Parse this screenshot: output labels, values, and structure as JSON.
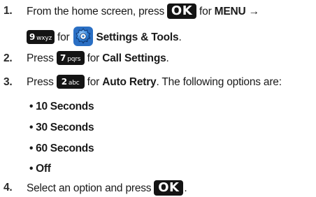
{
  "steps": [
    {
      "number": "1.",
      "pre": "From the home screen, press",
      "ok_key": "OK",
      "for1": "for",
      "menu": "MENU",
      "arrow": "→",
      "key9_digit": "9",
      "key9_letters": "wxyz",
      "for2": "for",
      "settings": "Settings & Tools",
      "end": "."
    },
    {
      "number": "2.",
      "pre": "Press",
      "key_digit": "7",
      "key_letters": "pqrs",
      "for": "for",
      "target": "Call Settings",
      "end": "."
    },
    {
      "number": "3.",
      "pre": "Press",
      "key_digit": "2",
      "key_letters": "abc",
      "for": "for",
      "target": "Auto Retry",
      "post": ". The following options are:"
    },
    {
      "number": "4.",
      "pre": "Select an option and press",
      "ok_key": "OK",
      "end": "."
    }
  ],
  "options": [
    "10 Seconds",
    "30 Seconds",
    "60 Seconds",
    "Off"
  ],
  "bullet": "•",
  "icons": {
    "settings": "settings-tools-gear-icon"
  },
  "colors": {
    "key_bg": "#141414",
    "gear_blue": "#2f7fd6"
  }
}
